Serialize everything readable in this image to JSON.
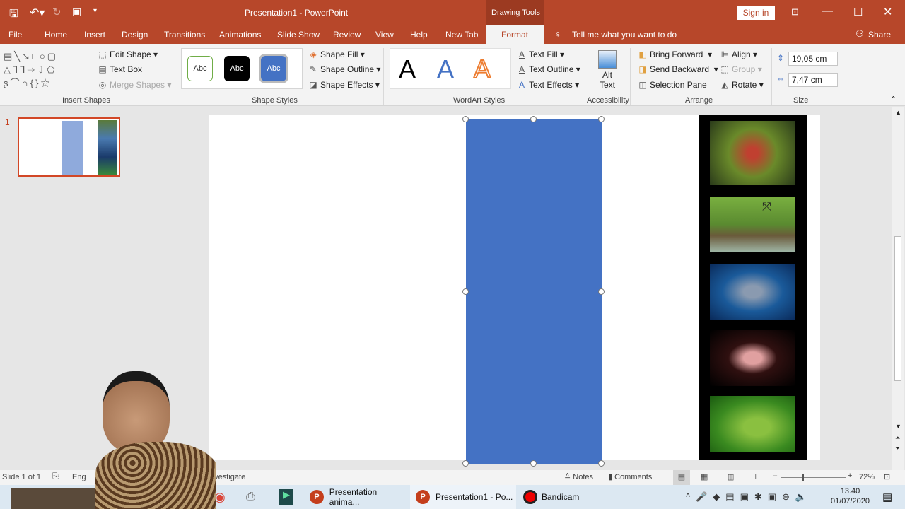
{
  "title_bar": {
    "title": "Presentation1  -  PowerPoint",
    "context_tab": "Drawing Tools",
    "sign_in": "Sign in"
  },
  "ribbon_tabs": [
    "File",
    "Home",
    "Insert",
    "Design",
    "Transitions",
    "Animations",
    "Slide Show",
    "Review",
    "View",
    "Help",
    "New Tab",
    "Format"
  ],
  "active_tab": "Format",
  "tell_me": "Tell me what you want to do",
  "share": "Share",
  "ribbon": {
    "insert_shapes": {
      "label": "Insert Shapes",
      "edit_shape": "Edit Shape",
      "text_box": "Text Box",
      "merge_shapes": "Merge Shapes"
    },
    "shape_styles": {
      "label": "Shape Styles",
      "presets": [
        "Abc",
        "Abc",
        "Abc"
      ],
      "shape_fill": "Shape Fill",
      "shape_outline": "Shape Outline",
      "shape_effects": "Shape Effects"
    },
    "wordart_styles": {
      "label": "WordArt Styles",
      "presets": [
        "A",
        "A",
        "A"
      ],
      "text_fill": "Text Fill",
      "text_outline": "Text Outline",
      "text_effects": "Text Effects"
    },
    "accessibility": {
      "label": "Accessibility",
      "alt_text_1": "Alt",
      "alt_text_2": "Text"
    },
    "arrange": {
      "label": "Arrange",
      "bring_forward": "Bring Forward",
      "send_backward": "Send Backward",
      "selection_pane": "Selection Pane",
      "align": "Align",
      "group": "Group",
      "rotate": "Rotate"
    },
    "size": {
      "label": "Size",
      "height": "19,05 cm",
      "width": "7,47 cm"
    }
  },
  "thumbnail": {
    "number": "1"
  },
  "colors": {
    "accent": "#b7472a",
    "shape_fill": "#4472c4"
  },
  "status_bar": {
    "slide_info": "Slide 1 of 1",
    "language": "Eng",
    "accessibility": "Investigate",
    "notes": "Notes",
    "comments": "Comments",
    "zoom": "72%"
  },
  "taskbar": {
    "items": [
      "Presentation anima...",
      "Presentation1 - Po...",
      "Bandicam"
    ],
    "time": "13.40",
    "date": "01/07/2020"
  }
}
